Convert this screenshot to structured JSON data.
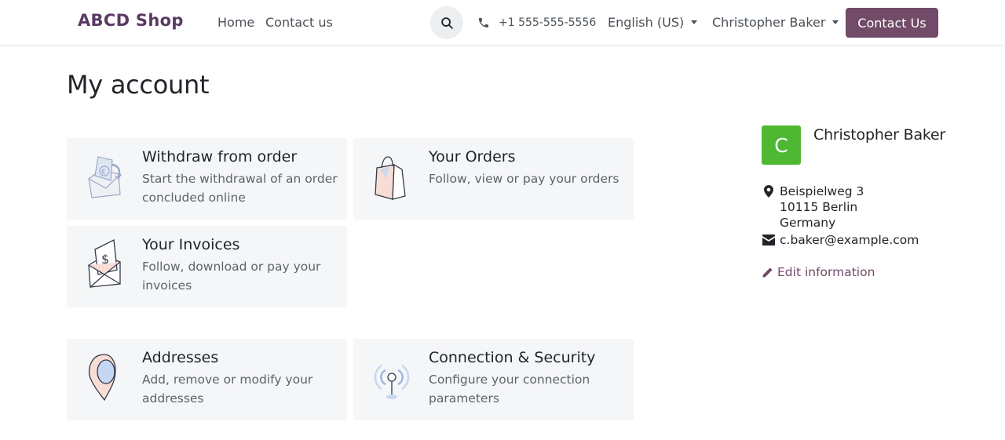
{
  "header": {
    "brand": "ABCD Shop",
    "nav": [
      "Home",
      "Contact us"
    ],
    "search_icon": "search-icon",
    "phone_icon": "phone-icon",
    "phone": "+1 555-555-5556",
    "language": "English (US)",
    "user": "Christopher Baker",
    "contact_button": "Contact Us"
  },
  "main": {
    "title": "My account",
    "cards": [
      {
        "title": "Withdraw from order",
        "desc": "Start the withdrawal of an order concluded online",
        "icon": "withdraw-envelope-icon"
      },
      {
        "title": "Your Orders",
        "desc": "Follow, view or pay your orders",
        "icon": "shopping-bag-icon"
      },
      {
        "title": "Your Invoices",
        "desc": "Follow, download or pay your invoices",
        "icon": "invoice-envelope-icon"
      },
      {
        "title": "Addresses",
        "desc": "Add, remove or modify your addresses",
        "icon": "map-pin-icon"
      },
      {
        "title": "Connection & Security",
        "desc": "Configure your connection parameters",
        "icon": "antenna-icon"
      }
    ]
  },
  "sidebar": {
    "avatar_letter": "C",
    "name": "Christopher Baker",
    "address": [
      "Beispielweg 3",
      "10115 Berlin",
      "Germany"
    ],
    "email": "c.baker@example.com",
    "edit_label": "Edit information"
  },
  "colors": {
    "brand": "#5a3a63",
    "primary": "#714b67",
    "avatar_bg": "#4fb833",
    "card_bg": "#f5f6f8"
  }
}
